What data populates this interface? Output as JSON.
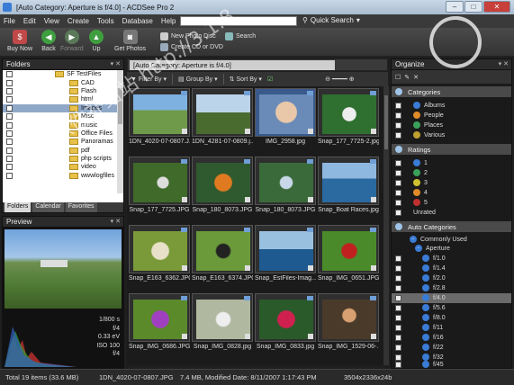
{
  "window": {
    "title": "[Auto Category: Aperture is f/4.0] - ACDSee Pro 2",
    "minimize": "–",
    "maximize": "□",
    "close": "✕"
  },
  "menu": [
    "File",
    "Edit",
    "View",
    "Create",
    "Tools",
    "Database",
    "Help"
  ],
  "quick_search": "Quick Search",
  "toolbar": {
    "buy_now": "Buy Now",
    "back": "Back",
    "forward": "Forward",
    "up": "Up",
    "get_photos": "Get Photos",
    "new_photo_disc": "New Photo Disc",
    "create_cd_dvd": "Create CD or DVD",
    "search": "Search"
  },
  "folders": {
    "title": "Folders",
    "items": [
      "SF TestFiles",
      "CAD",
      "Flash",
      "html",
      "Images",
      "Misc",
      "music",
      "Office Files",
      "Panoramas",
      "pdf",
      "php scripts",
      "video",
      "wwwlogfiles"
    ],
    "selected_index": 4,
    "tabs": [
      "Folders",
      "Calendar",
      "Favorites"
    ]
  },
  "preview": {
    "title": "Preview",
    "shutter": "1/800 s",
    "aperture": "f/4",
    "ev": "0.33 eV",
    "iso": "ISO 100",
    "f": "f/4"
  },
  "center": {
    "breadcrumb": "[Auto Category: Aperture is f/4.0]",
    "filter_by": "Filter By",
    "group_by": "Group By",
    "sort_by": "Sort By"
  },
  "thumbnails": [
    "1DN_4020-07-0807.J...",
    "1DN_4281-07-0809.j...",
    "IMG_2958.jpg",
    "Snap_177_7725-2.jpg",
    "Snap_177_7725.JPG",
    "Snap_180_8073.JPG",
    "Snap_180_8073.JPG",
    "Snap_Boat Races.jpg",
    "Snap_E163_6362.JPG",
    "Snap_E163_6374.JPG",
    "Snap_EstFiles-Imag...",
    "Snap_IMG_0651.JPG",
    "Snap_IMG_0686.JPG",
    "Snap_IMG_0828.jpg",
    "Snap_IMG_0833.jpg",
    "Snap_IMG_1529-06-..."
  ],
  "organize": {
    "title": "Organize",
    "categories_head": "Categories",
    "categories": [
      "Albums",
      "People",
      "Places",
      "Various"
    ],
    "ratings_head": "Ratings",
    "ratings": [
      "1",
      "2",
      "3",
      "4",
      "5",
      "Unrated"
    ],
    "auto_head": "Auto Categories",
    "commonly_used": "Commonly Used",
    "aperture": "Aperture",
    "apertures": [
      "f/1.0",
      "f/1.4",
      "f/2.0",
      "f/2.8",
      "f/4.0",
      "f/5.6",
      "f/8.0",
      "f/11",
      "f/16",
      "f/22",
      "f/32",
      "f/45"
    ],
    "selected_aperture_index": 4
  },
  "status": {
    "total": "Total 19 items  (33.6 MB)",
    "file": "1DN_4020-07-0807.JPG",
    "info": "7.4 MB, Modified Date: 8/11/2007 1:17:43 PM",
    "dims": "3504x2336x24b"
  },
  "watermark": "xyz软件补给站 http://3.1.8",
  "colors": {
    "accent": "#3a7bd5",
    "selection": "#8fa8c8",
    "folder": "#e8c14a"
  }
}
